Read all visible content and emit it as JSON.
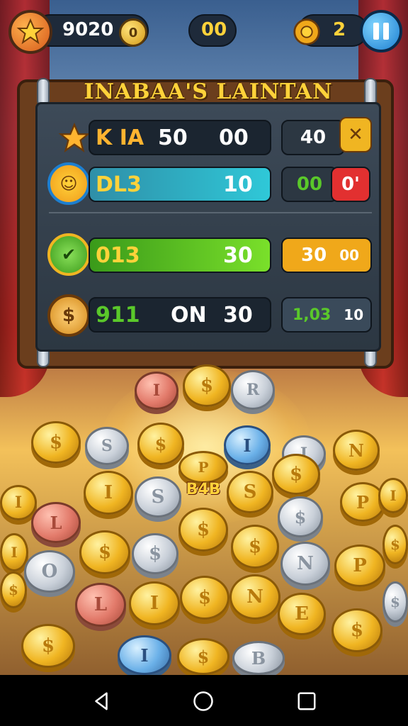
{
  "hud": {
    "coins": "9020",
    "coin_icon_text": "0",
    "score": "00",
    "level": "2",
    "icons": [
      "star-icon",
      "coin-icon",
      "gear-icon",
      "pause-icon"
    ]
  },
  "board": {
    "title": "INABAA'S LAINTAN",
    "rows": [
      {
        "icon": "star-icon",
        "label": "K IA",
        "value1": "50",
        "value2": "00",
        "side_value": "40",
        "side_icon": "close-icon",
        "bar_color": "#1b2530",
        "side_color": "#2c3742"
      },
      {
        "icon": "mascot-icon",
        "label": "DL3",
        "value1": "",
        "value2": "10",
        "side_value": "00",
        "side_badge": "0'",
        "bar_color": "#2fb8c8",
        "side_color": "#2c3742"
      },
      {
        "icon": "leaf-icon",
        "label": "013",
        "value1": "",
        "value2": "30",
        "side_value": "30",
        "side_value2": "00",
        "bar_color": "#5ac82a",
        "side_color": "#f0a81a"
      },
      {
        "icon": "trophy-icon",
        "label": "911",
        "value1": "ON",
        "value2": "30",
        "side_value": "1,03",
        "side_value2": "10",
        "bar_color": "#1b2530",
        "side_color": "#3a4a5a"
      }
    ]
  },
  "pile": {
    "center_label": "B4B",
    "coin_letters": [
      "I",
      "$",
      "R",
      "$",
      "S",
      "I",
      "N",
      "P",
      "S",
      "$",
      "I",
      "O",
      "L",
      "E",
      "B"
    ]
  },
  "colors": {
    "gold": "#f0b522",
    "title": "#ffd23a",
    "pause": "#1d7fd0"
  }
}
